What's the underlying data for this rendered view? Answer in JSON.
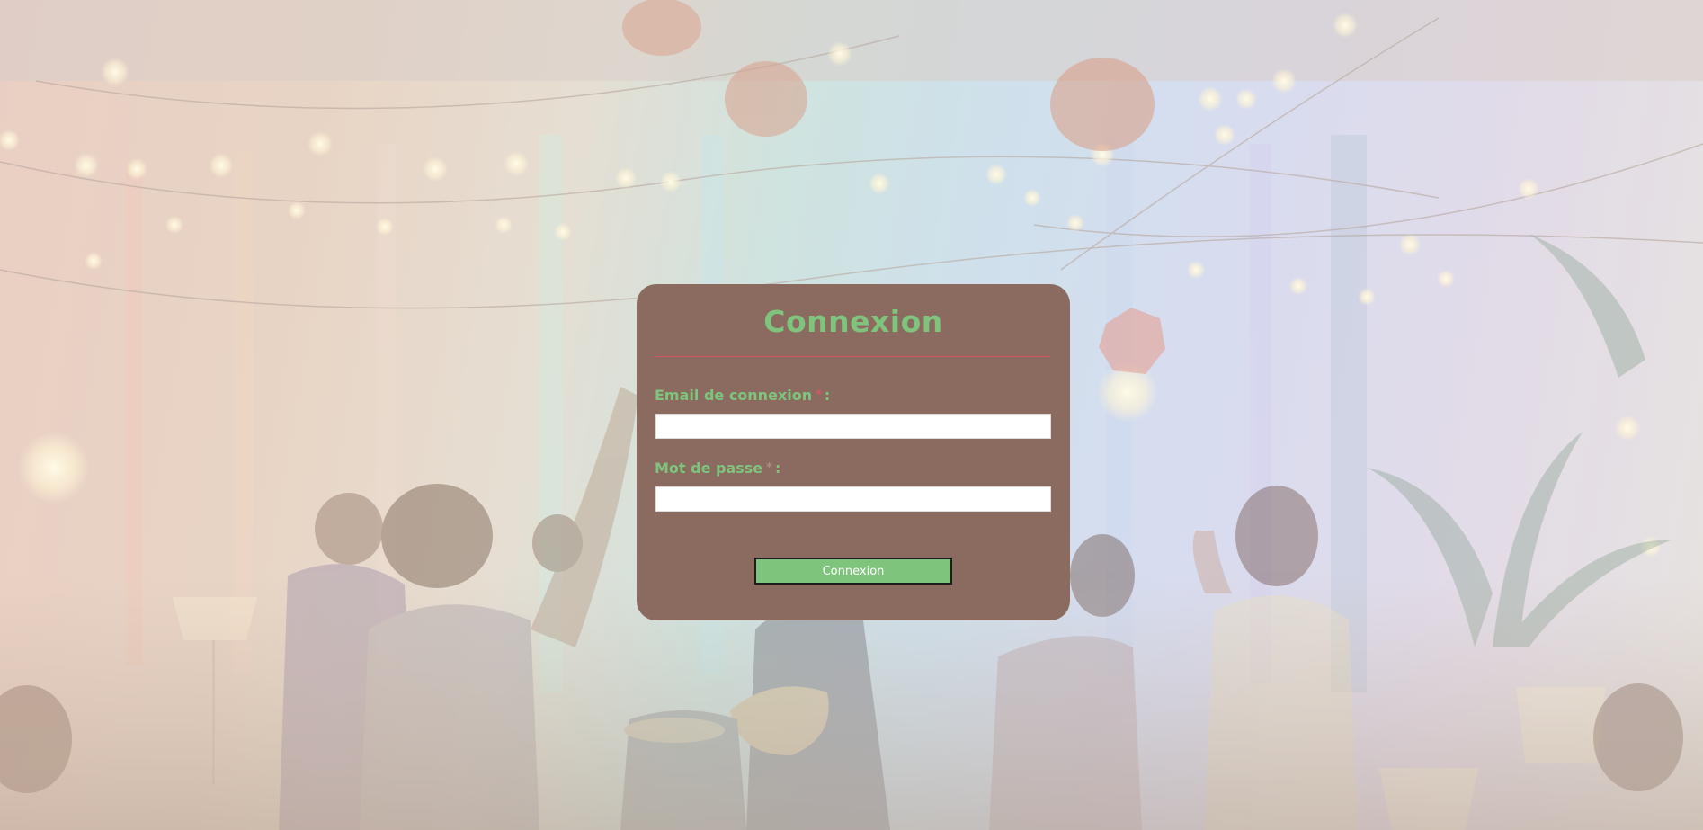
{
  "page": {
    "background": "party-scene-image"
  },
  "login": {
    "title": "Connexion",
    "email_label": "Email de connexion",
    "email_required_mark": "*",
    "email_colon": ":",
    "email_value": "",
    "password_label": "Mot de passe",
    "password_required_mark": "*",
    "password_colon": ":",
    "password_value": "",
    "submit_label": "Connexion"
  },
  "colors": {
    "card": "#8b6b60",
    "accent_green": "#7ec47d",
    "required_red": "#d2585f",
    "button_border": "#1c1c1c"
  }
}
